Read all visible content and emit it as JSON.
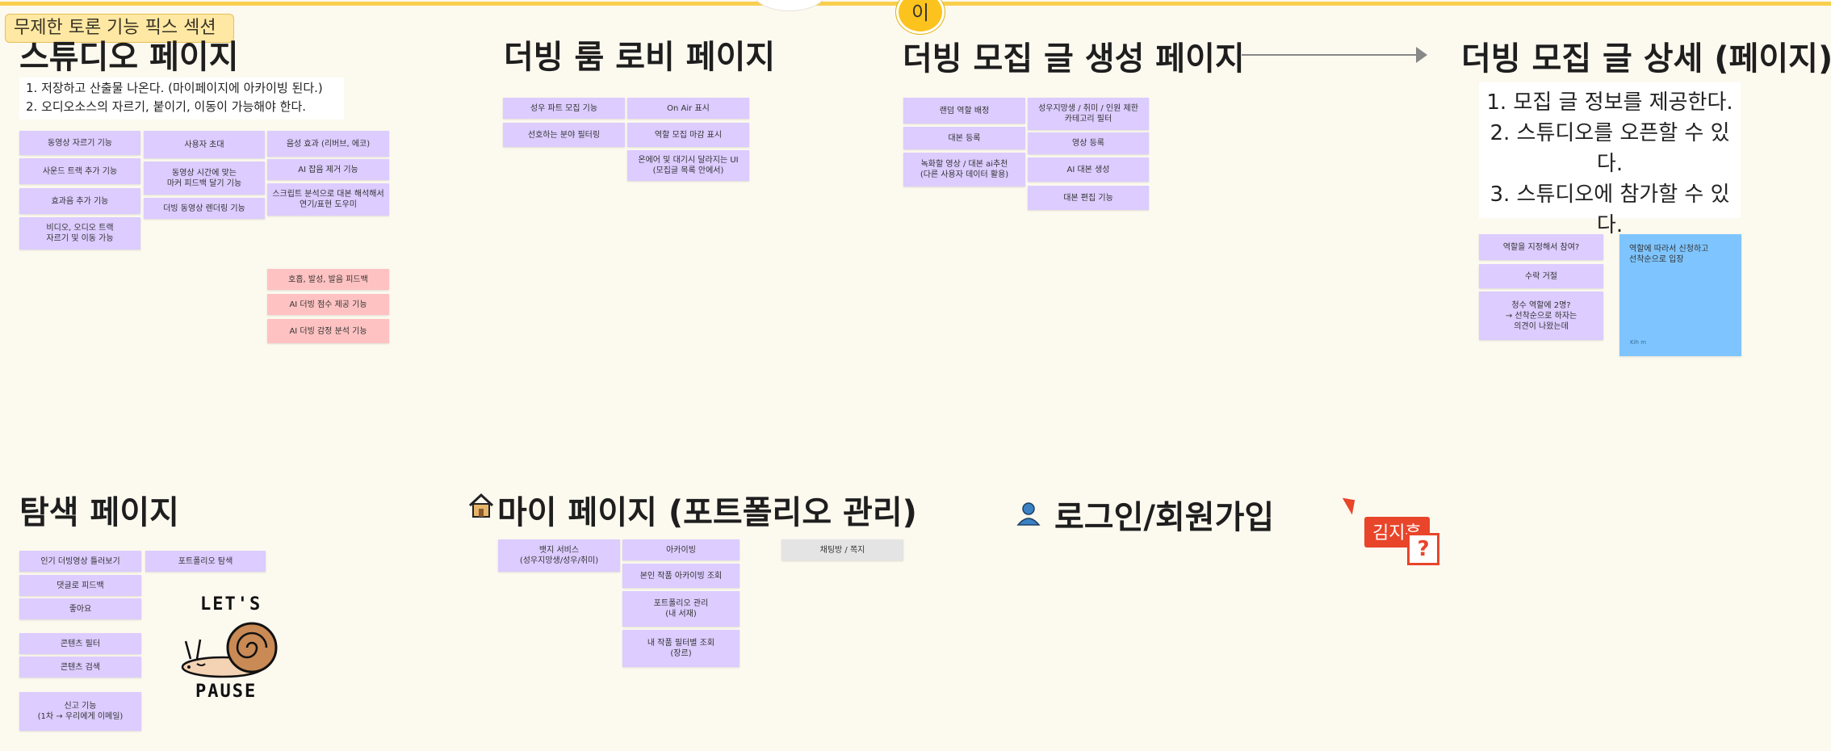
{
  "board": {
    "section_label": "무제한 토론 기능 픽스 섹션",
    "top_avatar_initial": "이"
  },
  "studio": {
    "title": "스튜디오 페이지",
    "requirements": [
      "1. 저장하고 산출물 나온다. (마이페이지에 아카이빙 된다.)",
      "2. 오디오소스의 자르기, 붙이기, 이동이 가능해야 한다."
    ],
    "notes_col1": [
      "동영상 자르기 기능",
      "사운드 트랙 추가 기능",
      "효과음 추가 기능",
      "비디오, 오디오 트랙\n자르기 및 이동 가능"
    ],
    "notes_col2": [
      "사용자 초대",
      "동영상 시간에 맞는\n마커 피드백 달기 기능",
      "더빙 동영상 렌더링 기능"
    ],
    "notes_col3": [
      "음성 효과 (리버브, 에코)",
      "AI 잡음 제거 기능",
      "스크립트 분석으로 대본 해석해서\n연기/표현 도우미"
    ],
    "notes_pink": [
      "호흡, 발성, 발음 피드백",
      "AI 더빙 점수 제공 기능",
      "AI 더빙 감정 분석 기능"
    ]
  },
  "lobby": {
    "title": "더빙 룸 로비 페이지",
    "notes_col1": [
      "성우 파트 모집 기능",
      "선호하는 분야 필터링"
    ],
    "notes_col2": [
      "On Air 표시",
      "역할 모집 마감 표시",
      "온에어 및 대기시 달라지는 UI\n(모집글 목록 안에서)"
    ]
  },
  "recruit_create": {
    "title": "더빙 모집 글 생성 페이지",
    "notes_col1": [
      "랜덤 역할 배정",
      "대본 등록",
      "녹화할 영상 / 대본 ai추천\n(다른 사용자 데이터 활용)"
    ],
    "notes_col2": [
      "성우지망생 / 취미 / 인원 제한\n카테고리 필터",
      "영상 등록",
      "AI 대본 생성",
      "대본 편집 기능"
    ]
  },
  "recruit_detail": {
    "title": "더빙 모집 글 상세 (페이지)",
    "requirements": [
      "1. 모집 글 정보를 제공한다.",
      "2. 스튜디오를 오픈할 수 있다.",
      "3. 스튜디오에 참가할 수 있다."
    ],
    "notes": [
      "역할을 지정해서 참여?",
      "수락 거절",
      "청수 역할에 2명?\n→ 선착순으로 하자는\n의견이 나왔는데"
    ],
    "blue_note": "역할에 따라서 신청하고\n선착순으로 입장",
    "blue_note_author": "Kih m"
  },
  "explore": {
    "title": "탐색 페이지",
    "notes_col1": [
      "인기 더빙영상 틀러보기",
      "댓글로 피드백",
      "좋아요",
      "콘텐츠 필터",
      "콘텐츠 검색",
      "신고 기능\n(1차 → 우리에게 이메일)"
    ],
    "notes_col2": [
      "포트폴리오 탐색"
    ],
    "sticker_top": "LET'S",
    "sticker_bottom": "PAUSE"
  },
  "mypage": {
    "title": "마이 페이지 (포트폴리오 관리)",
    "notes_col1": [
      "뱃지 서비스\n(성우지망생/성우/취미)"
    ],
    "notes_col2": [
      "아카이빙",
      "본인 작품 아카이빙 조회",
      "포트폴리오 관리\n(내 서재)",
      "내 작품 필터별 조회\n(장르)"
    ],
    "notes_gray": [
      "채팅방 / 쪽지"
    ]
  },
  "login": {
    "title": "로그인/회원가입"
  },
  "cursor": {
    "user_name": "김지훈"
  },
  "icons": {
    "house": "house-icon",
    "user": "user-icon",
    "help": "help-icon"
  }
}
